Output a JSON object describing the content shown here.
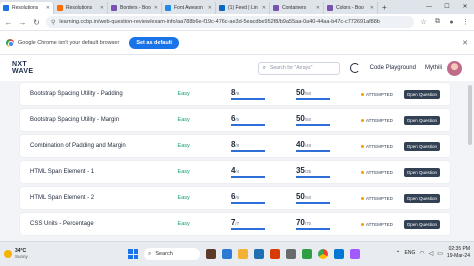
{
  "browser": {
    "tabs": [
      {
        "label": "Resolutions",
        "active": true,
        "color": "#1a73e8"
      },
      {
        "label": "Resolutions",
        "active": false,
        "color": "#ff6d00"
      },
      {
        "label": "Borders - Boo",
        "active": false,
        "color": "#7952b3"
      },
      {
        "label": "Font Aweson",
        "active": false,
        "color": "#228ae6"
      },
      {
        "label": "(1) Feed | Lin",
        "active": false,
        "color": "#0a66c2"
      },
      {
        "label": "Containers",
        "active": false,
        "color": "#7952b3"
      },
      {
        "label": "Colors - Boo",
        "active": false,
        "color": "#7952b3"
      }
    ],
    "url": "learning.ccbp.in/web-question-review/exam-info/aa788b6e-f19c-476c-ae3d-5eacdbe952f8/b9a55aa-0a40-44aa-b47c-c772691af88b",
    "banner_text": "Google Chrome isn't your default browser",
    "set_default_label": "Set as default"
  },
  "app": {
    "logo_line1": "NXT",
    "logo_line2": "WAVE",
    "search_placeholder": "Search for \"Arrays\"",
    "code_playground": "Code Playground",
    "user_name": "Mythili"
  },
  "questions": [
    {
      "title": "Bootstrap Spacing Utility - Padding",
      "difficulty": "Easy",
      "score": "8",
      "score_total": "/8",
      "score_fraction": 1.0,
      "attempts": "50",
      "attempts_total": "/50",
      "attempts_fraction": 1.0,
      "status": "ATTEMPTED",
      "action": "Open Question"
    },
    {
      "title": "Bootstrap Spacing Utility - Margin",
      "difficulty": "Easy",
      "score": "6",
      "score_total": "/6",
      "score_fraction": 1.0,
      "attempts": "50",
      "attempts_total": "/50",
      "attempts_fraction": 1.0,
      "status": "ATTEMPTED",
      "action": "Open Question"
    },
    {
      "title": "Combination of Padding and Margin",
      "difficulty": "Easy",
      "score": "8",
      "score_total": "/8",
      "score_fraction": 1.0,
      "attempts": "40",
      "attempts_total": "/40",
      "attempts_fraction": 1.0,
      "status": "ATTEMPTED",
      "action": "Open Question"
    },
    {
      "title": "HTML Span Element - 1",
      "difficulty": "Easy",
      "score": "4",
      "score_total": "/4",
      "score_fraction": 1.0,
      "attempts": "35",
      "attempts_total": "/35",
      "attempts_fraction": 1.0,
      "status": "ATTEMPTED",
      "action": "Open Question"
    },
    {
      "title": "HTML Span Element - 2",
      "difficulty": "Easy",
      "score": "6",
      "score_total": "/6",
      "score_fraction": 1.0,
      "attempts": "50",
      "attempts_total": "/50",
      "attempts_fraction": 1.0,
      "status": "ATTEMPTED",
      "action": "Open Question"
    },
    {
      "title": "CSS Units - Percentage",
      "difficulty": "Easy",
      "score": "7",
      "score_total": "/7",
      "score_fraction": 1.0,
      "attempts": "70",
      "attempts_total": "/70",
      "attempts_fraction": 1.0,
      "status": "ATTEMPTED",
      "action": "Open Question"
    }
  ],
  "taskbar": {
    "temperature": "34°C",
    "condition": "Sunny",
    "search_label": "Search",
    "language": "ENG",
    "time": "02:35 PM",
    "date": "19-Mar-24"
  },
  "colors": {
    "accent": "#1a73e8",
    "easy": "#0d9b6d",
    "progress": "#2f6fd8",
    "status_dot": "#f59e0b",
    "button": "#334155"
  }
}
